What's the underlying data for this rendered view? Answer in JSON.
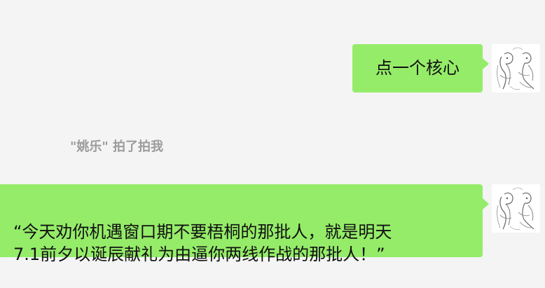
{
  "messages": [
    {
      "text": "点一个核心"
    },
    {
      "text": "“今天劝你机遇窗口期不要梧桐的那批人，就是明天\n7.1前夕以诞辰献礼为由逼你两线作战的那批人！”"
    }
  ],
  "system_notice": {
    "text": "\"姚乐\" 拍了拍我"
  },
  "colors": {
    "background": "#f4f4f4",
    "bubble_green": "#95ec69",
    "system_text": "#9b9b9b"
  }
}
